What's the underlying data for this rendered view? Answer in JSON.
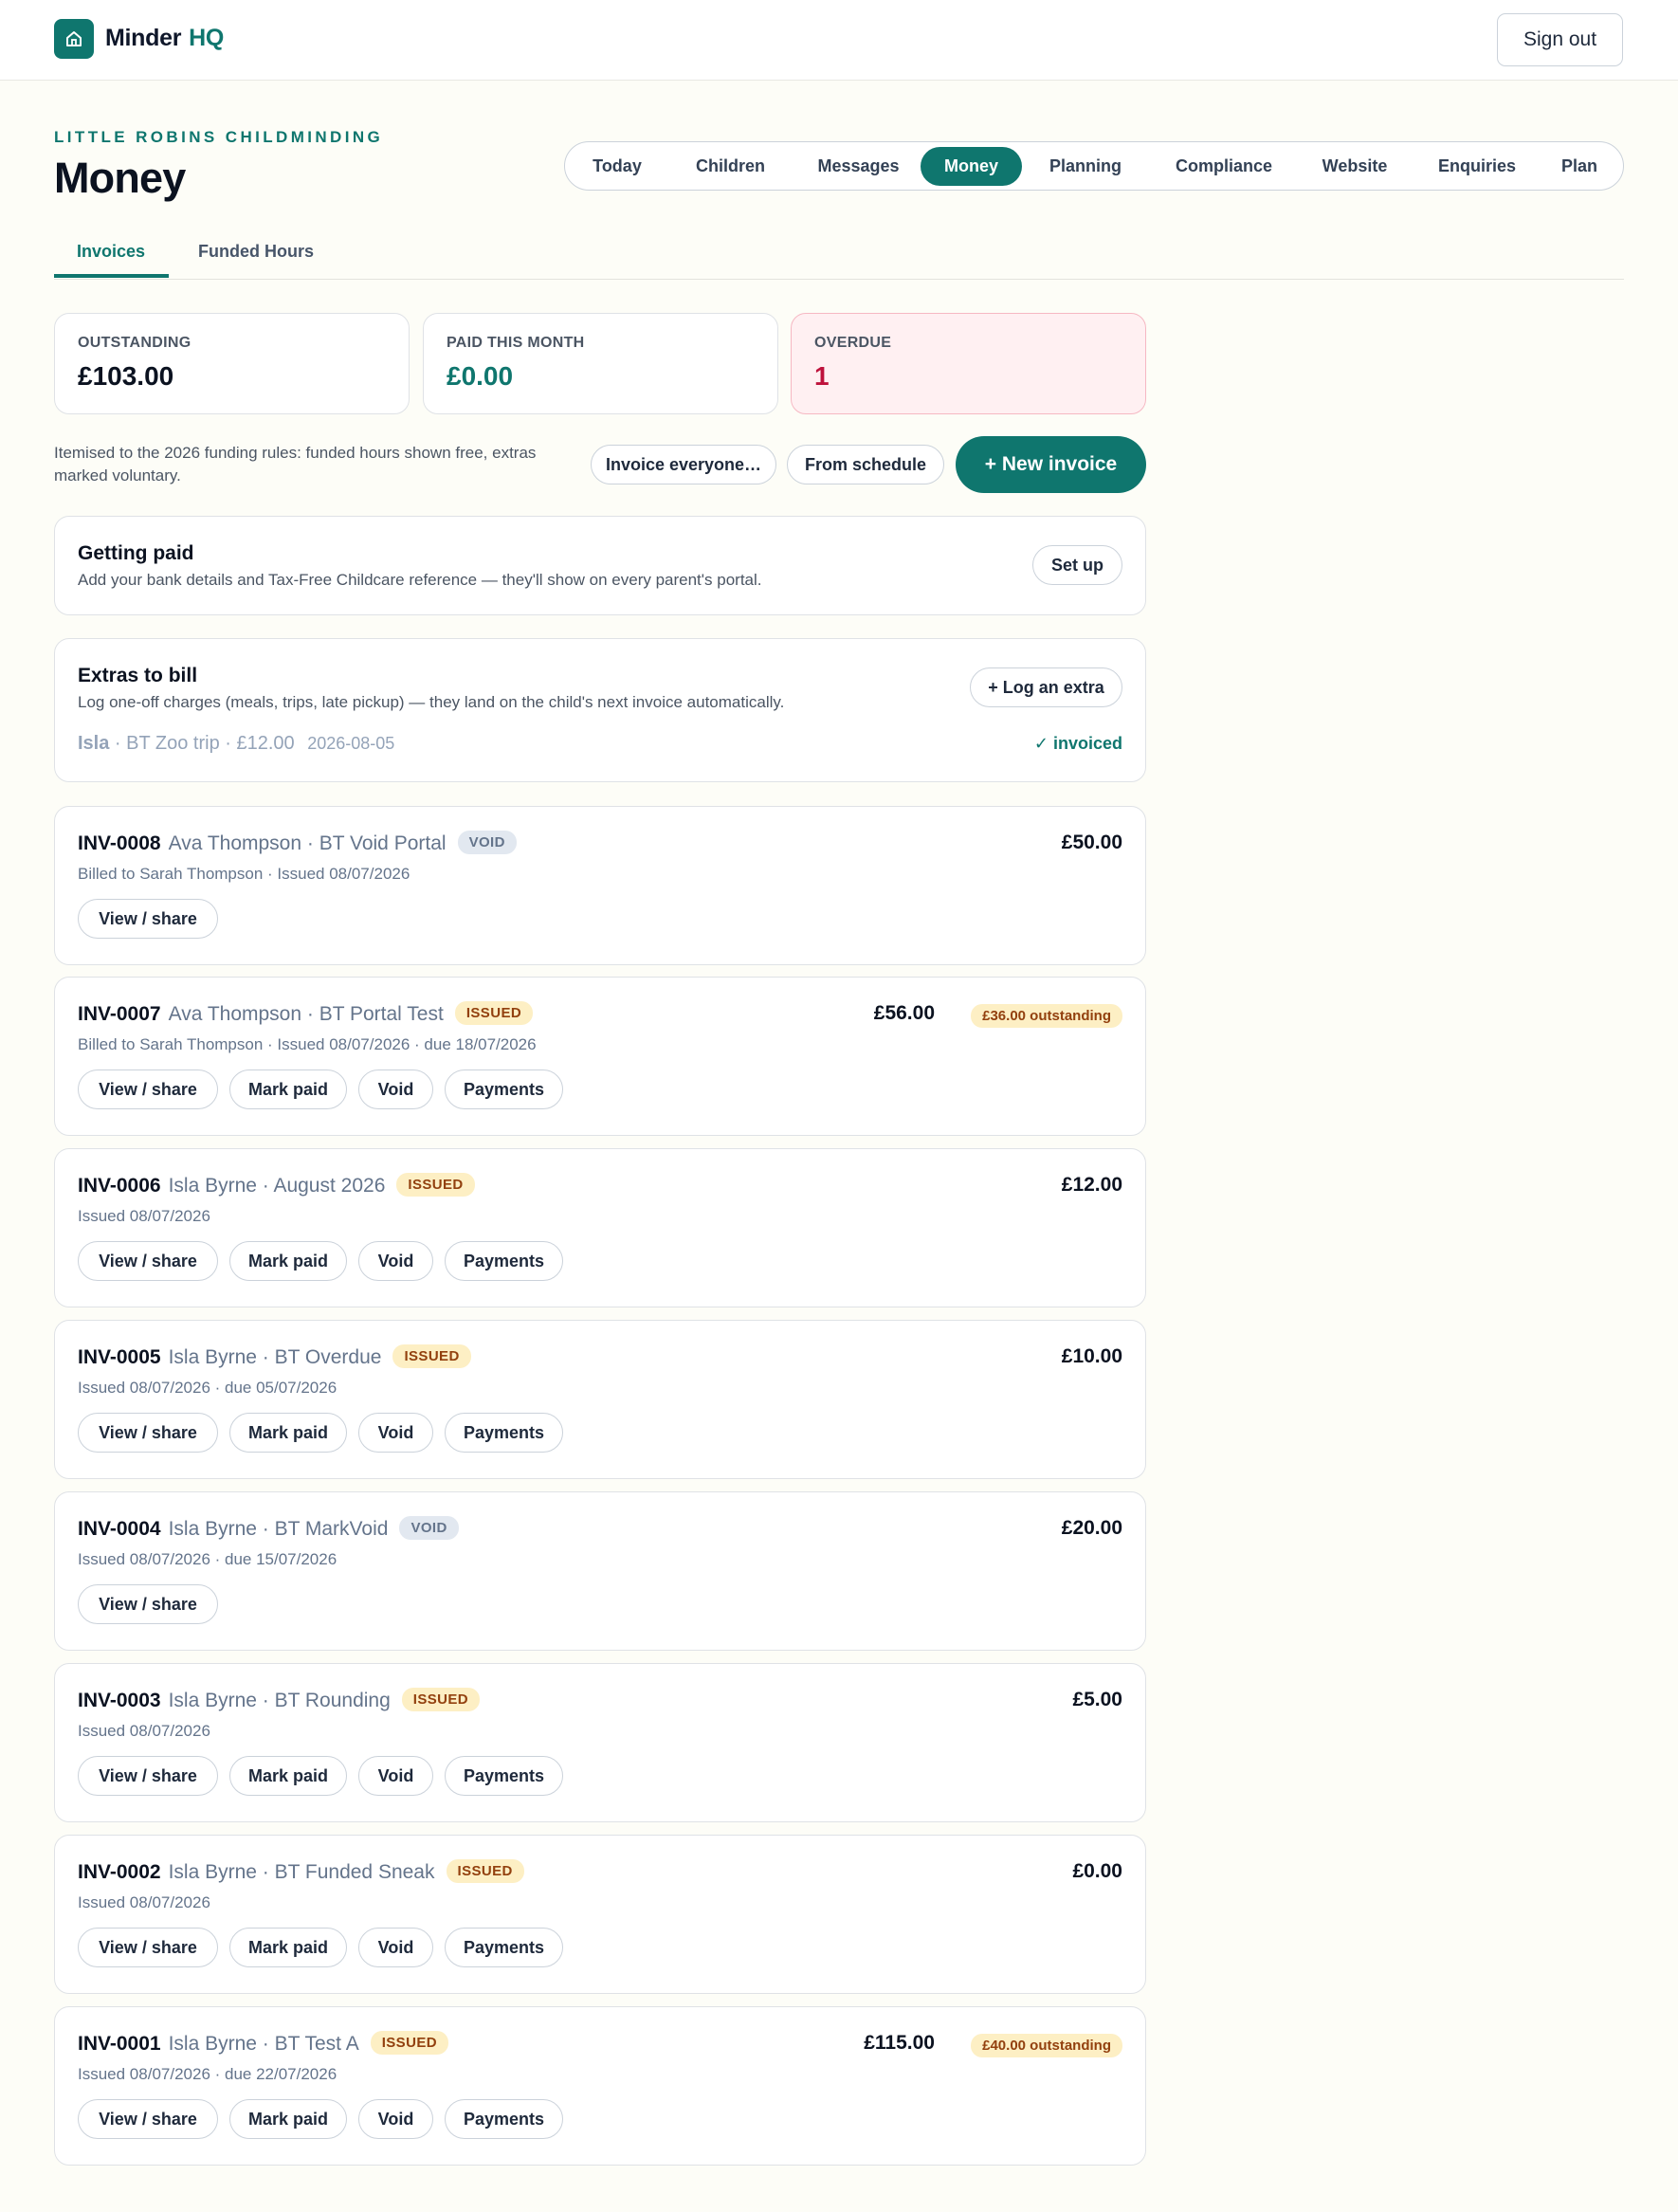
{
  "header": {
    "brand_name": "Minder",
    "brand_suffix": "HQ",
    "signout_label": "Sign out"
  },
  "page": {
    "org_name": "LITTLE ROBINS CHILDMINDING",
    "title": "Money"
  },
  "nav": {
    "items": [
      "Today",
      "Children",
      "Messages",
      "Money",
      "Planning",
      "Compliance",
      "Website",
      "Enquiries",
      "Plan"
    ],
    "active": "Money"
  },
  "subtabs": {
    "items": [
      "Invoices",
      "Funded Hours"
    ],
    "active": "Invoices"
  },
  "stats": {
    "outstanding": {
      "label": "OUTSTANDING",
      "value": "£103.00"
    },
    "paid": {
      "label": "PAID THIS MONTH",
      "value": "£0.00"
    },
    "overdue": {
      "label": "OVERDUE",
      "value": "1"
    }
  },
  "actions": {
    "note": "Itemised to the 2026 funding rules: funded hours shown free, extras marked voluntary.",
    "invoice_everyone": "Invoice everyone…",
    "from_schedule": "From schedule",
    "new_invoice": "+ New invoice"
  },
  "getting_paid": {
    "title": "Getting paid",
    "desc": "Add your bank details and Tax-Free Childcare reference — they'll show on every parent's portal.",
    "button": "Set up"
  },
  "extras": {
    "title": "Extras to bill",
    "desc": "Log one-off charges (meals, trips, late pickup) — they land on the child's next invoice automatically.",
    "button": "+ Log an extra",
    "item_child": "Isla",
    "item_text": "· BT Zoo trip · £12.00",
    "item_date": "2026-08-05",
    "item_status": "✓ invoiced"
  },
  "buttons": {
    "view": "View / share",
    "mark_paid": "Mark paid",
    "void": "Void",
    "payments": "Payments"
  },
  "invoices": [
    {
      "number": "INV-0008",
      "who": "Ava Thompson · BT Void Portal",
      "status": "VOID",
      "meta": "Billed to Sarah Thompson · Issued 08/07/2026",
      "amount": "£50.00",
      "outstanding": ""
    },
    {
      "number": "INV-0007",
      "who": "Ava Thompson · BT Portal Test",
      "status": "ISSUED",
      "meta": "Billed to Sarah Thompson · Issued 08/07/2026 · due 18/07/2026",
      "amount": "£56.00",
      "outstanding": "£36.00 outstanding"
    },
    {
      "number": "INV-0006",
      "who": "Isla Byrne · August 2026",
      "status": "ISSUED",
      "meta": "Issued 08/07/2026",
      "amount": "£12.00",
      "outstanding": ""
    },
    {
      "number": "INV-0005",
      "who": "Isla Byrne · BT Overdue",
      "status": "ISSUED",
      "meta": "Issued 08/07/2026 · due 05/07/2026",
      "amount": "£10.00",
      "outstanding": ""
    },
    {
      "number": "INV-0004",
      "who": "Isla Byrne · BT MarkVoid",
      "status": "VOID",
      "meta": "Issued 08/07/2026 · due 15/07/2026",
      "amount": "£20.00",
      "outstanding": ""
    },
    {
      "number": "INV-0003",
      "who": "Isla Byrne · BT Rounding",
      "status": "ISSUED",
      "meta": "Issued 08/07/2026",
      "amount": "£5.00",
      "outstanding": ""
    },
    {
      "number": "INV-0002",
      "who": "Isla Byrne · BT Funded Sneak",
      "status": "ISSUED",
      "meta": "Issued 08/07/2026",
      "amount": "£0.00",
      "outstanding": ""
    },
    {
      "number": "INV-0001",
      "who": "Isla Byrne · BT Test A",
      "status": "ISSUED",
      "meta": "Issued 08/07/2026 · due 22/07/2026",
      "amount": "£115.00",
      "outstanding": "£40.00 outstanding"
    }
  ]
}
